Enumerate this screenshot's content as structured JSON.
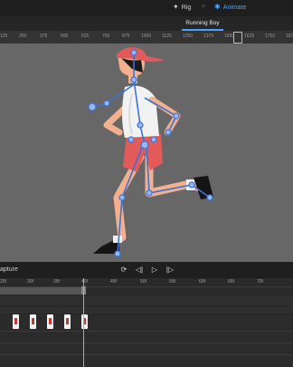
{
  "modes": [
    {
      "label": "Rig",
      "icon": "rig-icon"
    },
    {
      "label": "Animate",
      "icon": "animate-icon"
    }
  ],
  "mode_separator": ">",
  "document": {
    "title": "Running Boy"
  },
  "ruler": {
    "ticks": [
      "125",
      "250",
      "375",
      "500",
      "625",
      "750",
      "875",
      "1000",
      "1125",
      "1250",
      "1375",
      "1500",
      "1625",
      "1750",
      "1875"
    ]
  },
  "playback": {
    "label": "apture",
    "buttons": [
      {
        "name": "loop",
        "glyph": "⟳"
      },
      {
        "name": "prev",
        "glyph": "◁|"
      },
      {
        "name": "play",
        "glyph": "▷"
      },
      {
        "name": "next",
        "glyph": "|▷"
      }
    ]
  },
  "timeline": {
    "ticks": [
      "25f",
      "30f",
      "35f",
      "40f",
      "45f",
      "50f",
      "55f",
      "60f",
      "65f",
      "70f"
    ],
    "keyframes": 5
  },
  "colors": {
    "accent": "#4aa3ff",
    "bone": "#3a72d6",
    "cap": "#e35a5a",
    "skin": "#f2b08e"
  }
}
